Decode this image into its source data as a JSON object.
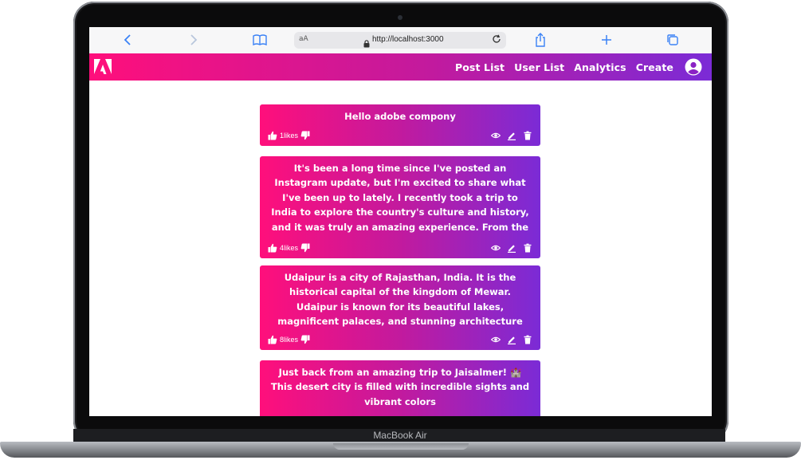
{
  "device": {
    "model_label": "MacBook Air"
  },
  "browser": {
    "text_size_label": "aA",
    "url": "http://localhost:3000"
  },
  "app": {
    "nav": {
      "items": [
        "Post List",
        "User List",
        "Analytics",
        "Create"
      ]
    },
    "colors": {
      "gradient_start": "#ff0f7b",
      "gradient_end": "#7b2bd6"
    }
  },
  "posts": [
    {
      "text": "Hello adobe compony",
      "likes": "1likes"
    },
    {
      "text": "It's been a long time since I've posted an Instagram update, but I'm excited to share what I've been up to lately. I recently took a trip to India to explore the country's culture and history, and it was truly an amazing experience. From the",
      "likes": "4likes"
    },
    {
      "text": "Udaipur is a city of Rajasthan, India. It is the historical capital of the kingdom of Mewar. Udaipur is known for its beautiful lakes, magnificent palaces, and stunning architecture",
      "likes": "8likes"
    },
    {
      "text": "Just back from an amazing trip to Jaisalmer! 🏰 This desert city is filled with incredible sights and vibrant colors",
      "likes": ""
    }
  ]
}
